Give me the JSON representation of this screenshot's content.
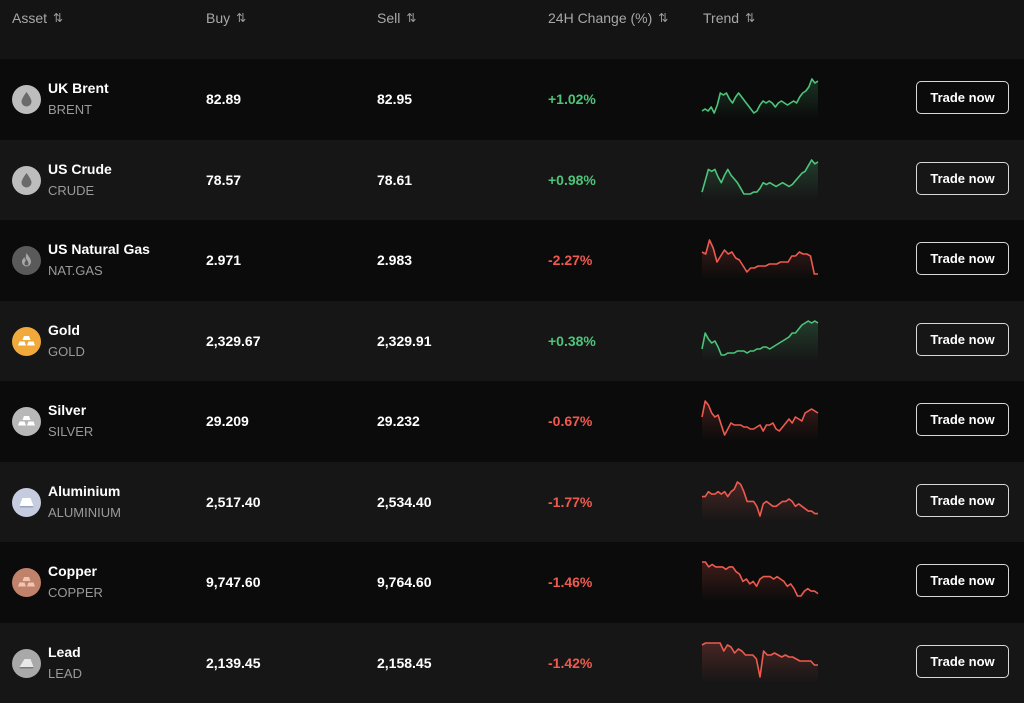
{
  "header": {
    "columns": [
      {
        "key": "asset",
        "label": "Asset",
        "sort_icon": "sort-arrows-icon"
      },
      {
        "key": "buy",
        "label": "Buy",
        "sort_icon": "sort-arrows-icon"
      },
      {
        "key": "sell",
        "label": "Sell",
        "sort_icon": "sort-arrows-icon"
      },
      {
        "key": "change",
        "label": "24H Change (%)",
        "sort_icon": "sort-arrows-icon"
      },
      {
        "key": "trend",
        "label": "Trend",
        "sort_icon": "sort-arrows-icon"
      }
    ],
    "sort_glyph": "⇅"
  },
  "colors": {
    "up": "#4ec47a",
    "down": "#ef5a4f"
  },
  "rows": [
    {
      "name": "UK Brent",
      "code": "BRENT",
      "icon": "oil-drop-icon",
      "icon_bg": "#bdbdbd",
      "icon_fg": "#6a6a6a",
      "buy": "82.89",
      "sell": "82.95",
      "change": "+1.02%",
      "direction": "up",
      "trend": [
        3,
        4,
        3,
        5,
        2,
        6,
        12,
        11,
        12,
        9,
        7,
        10,
        12,
        10,
        8,
        6,
        4,
        2,
        3,
        6,
        8,
        7,
        8,
        7,
        5,
        7,
        8,
        7,
        6,
        7,
        8,
        7,
        10,
        12,
        13,
        15,
        19,
        17,
        18
      ],
      "action": "Trade now"
    },
    {
      "name": "US Crude",
      "code": "CRUDE",
      "icon": "oil-drop-icon",
      "icon_bg": "#bdbdbd",
      "icon_fg": "#6a6a6a",
      "buy": "78.57",
      "sell": "78.61",
      "change": "+0.98%",
      "direction": "up",
      "trend": [
        1,
        7,
        13,
        12,
        13,
        9,
        6,
        10,
        13,
        10,
        8,
        6,
        3,
        0,
        0,
        0,
        1,
        1,
        3,
        6,
        5,
        6,
        5,
        4,
        5,
        6,
        5,
        4,
        5,
        7,
        9,
        11,
        12,
        15,
        18,
        16,
        17
      ],
      "action": "Trade now"
    },
    {
      "name": "US Natural Gas",
      "code": "NAT.GAS",
      "icon": "flame-icon",
      "icon_bg": "#5a5a5a",
      "icon_fg": "#a8a8a8",
      "buy": "2.971",
      "sell": "2.983",
      "change": "-2.27%",
      "direction": "down",
      "trend": [
        12,
        11,
        18,
        14,
        7,
        10,
        13,
        11,
        12,
        9,
        8,
        5,
        2,
        4,
        4,
        5,
        5,
        5,
        6,
        6,
        6,
        7,
        7,
        7,
        10,
        10,
        12,
        11,
        11,
        10,
        1,
        1
      ],
      "action": "Trade now"
    },
    {
      "name": "Gold",
      "code": "GOLD",
      "icon": "gold-bars-icon",
      "icon_bg": "#f0a93a",
      "icon_fg": "#ffffff",
      "buy": "2,329.67",
      "sell": "2,329.91",
      "change": "+0.38%",
      "direction": "up",
      "trend": [
        4,
        12,
        9,
        7,
        8,
        5,
        1,
        1,
        2,
        2,
        2,
        3,
        3,
        3,
        2,
        3,
        3,
        4,
        4,
        5,
        5,
        4,
        5,
        6,
        7,
        8,
        9,
        10,
        12,
        12,
        14,
        16,
        17,
        18,
        17,
        18,
        17
      ],
      "action": "Trade now"
    },
    {
      "name": "Silver",
      "code": "SILVER",
      "icon": "silver-bars-icon",
      "icon_bg": "#b8b8b8",
      "icon_fg": "#ffffff",
      "buy": "29.209",
      "sell": "29.232",
      "change": "-0.67%",
      "direction": "down",
      "trend": [
        10,
        18,
        16,
        12,
        10,
        11,
        6,
        1,
        4,
        7,
        6,
        6,
        6,
        5,
        5,
        4,
        4,
        5,
        6,
        3,
        6,
        6,
        7,
        4,
        3,
        5,
        7,
        9,
        7,
        10,
        9,
        8,
        12,
        13,
        14,
        13,
        12
      ],
      "action": "Trade now"
    },
    {
      "name": "Aluminium",
      "code": "ALUMINIUM",
      "icon": "aluminium-ingot-icon",
      "icon_bg": "#c5cce0",
      "icon_fg": "#ffffff",
      "buy": "2,517.40",
      "sell": "2,534.40",
      "change": "-1.77%",
      "direction": "down",
      "trend": [
        10,
        10,
        12,
        11,
        11,
        12,
        11,
        12,
        10,
        12,
        13,
        16,
        15,
        12,
        8,
        8,
        8,
        6,
        2,
        7,
        8,
        7,
        6,
        6,
        7,
        8,
        8,
        9,
        8,
        6,
        7,
        6,
        5,
        4,
        4,
        3,
        3
      ],
      "action": "Trade now"
    },
    {
      "name": "Copper",
      "code": "COPPER",
      "icon": "copper-bars-icon",
      "icon_bg": "#c0826a",
      "icon_fg": "#f1c5b2",
      "buy": "9,747.60",
      "sell": "9,764.60",
      "change": "-1.46%",
      "direction": "down",
      "trend": [
        17,
        17,
        15,
        16,
        15,
        15,
        15,
        14,
        15,
        15,
        13,
        12,
        9,
        10,
        8,
        9,
        7,
        10,
        11,
        11,
        11,
        10,
        11,
        10,
        9,
        7,
        8,
        6,
        3,
        3,
        5,
        6,
        5,
        5,
        4
      ],
      "action": "Trade now"
    },
    {
      "name": "Lead",
      "code": "LEAD",
      "icon": "lead-ingot-icon",
      "icon_bg": "#a9a9a9",
      "icon_fg": "#e8e8e8",
      "buy": "2,139.45",
      "sell": "2,158.45",
      "change": "-1.42%",
      "direction": "down",
      "trend": [
        16,
        17,
        17,
        17,
        17,
        17,
        13,
        16,
        15,
        12,
        14,
        13,
        11,
        11,
        11,
        9,
        0,
        13,
        11,
        11,
        12,
        11,
        10,
        11,
        10,
        10,
        9,
        8,
        8,
        8,
        8,
        6,
        6
      ],
      "action": "Trade now"
    }
  ]
}
